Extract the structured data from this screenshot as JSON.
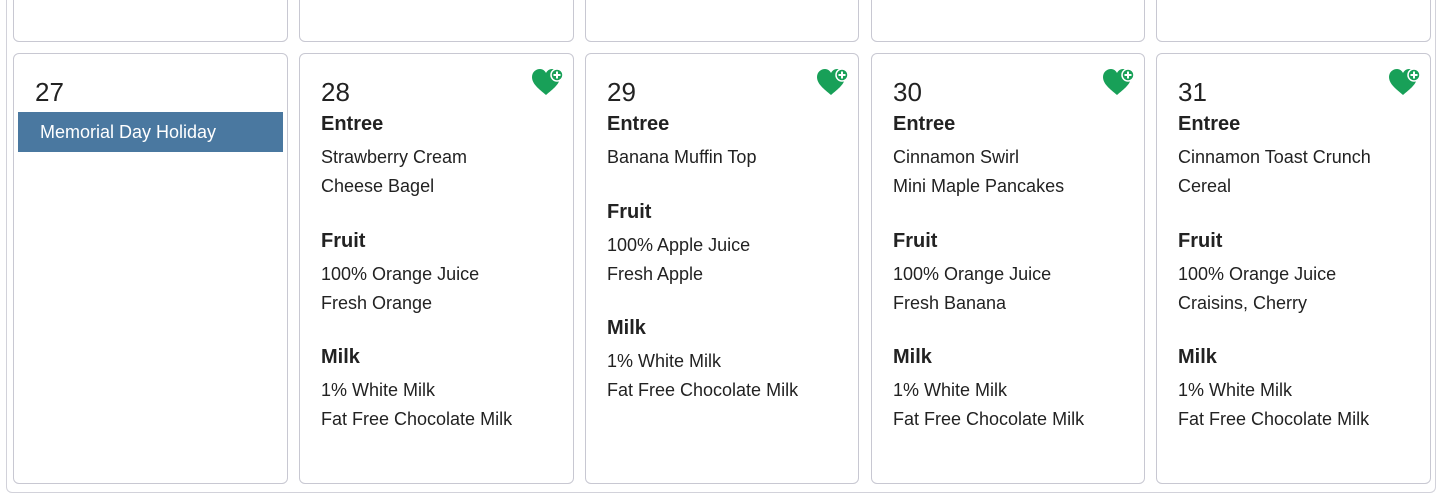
{
  "prev_week": [
    {},
    {},
    {},
    {},
    {}
  ],
  "colors": {
    "holiday_bg": "#4a78a0",
    "heart": "#18a058",
    "border": "#c8c8d2"
  },
  "days": [
    {
      "date": "27",
      "holiday": "Memorial Day Holiday"
    },
    {
      "date": "28",
      "icon": "heart-plus-icon",
      "entree_title": "Entree",
      "entree": [
        "Strawberry Cream",
        "Cheese Bagel"
      ],
      "fruit_title": "Fruit",
      "fruit": [
        "100% Orange Juice",
        "Fresh Orange"
      ],
      "milk_title": "Milk",
      "milk": [
        "1% White Milk",
        "Fat Free Chocolate Milk"
      ]
    },
    {
      "date": "29",
      "icon": "heart-plus-icon",
      "entree_title": "Entree",
      "entree": [
        "Banana Muffin Top"
      ],
      "fruit_title": "Fruit",
      "fruit": [
        "100% Apple Juice",
        "Fresh Apple"
      ],
      "milk_title": "Milk",
      "milk": [
        "1% White Milk",
        "Fat Free Chocolate Milk"
      ]
    },
    {
      "date": "30",
      "icon": "heart-plus-icon",
      "entree_title": "Entree",
      "entree": [
        "Cinnamon Swirl",
        "Mini Maple Pancakes"
      ],
      "fruit_title": "Fruit",
      "fruit": [
        "100% Orange Juice",
        "Fresh Banana"
      ],
      "milk_title": "Milk",
      "milk": [
        "1% White Milk",
        "Fat Free Chocolate Milk"
      ]
    },
    {
      "date": "31",
      "icon": "heart-plus-icon",
      "entree_title": "Entree",
      "entree": [
        "Cinnamon Toast Crunch",
        "Cereal"
      ],
      "fruit_title": "Fruit",
      "fruit": [
        "100% Orange Juice",
        "Craisins, Cherry"
      ],
      "milk_title": "Milk",
      "milk": [
        "1% White Milk",
        "Fat Free Chocolate Milk"
      ]
    }
  ]
}
